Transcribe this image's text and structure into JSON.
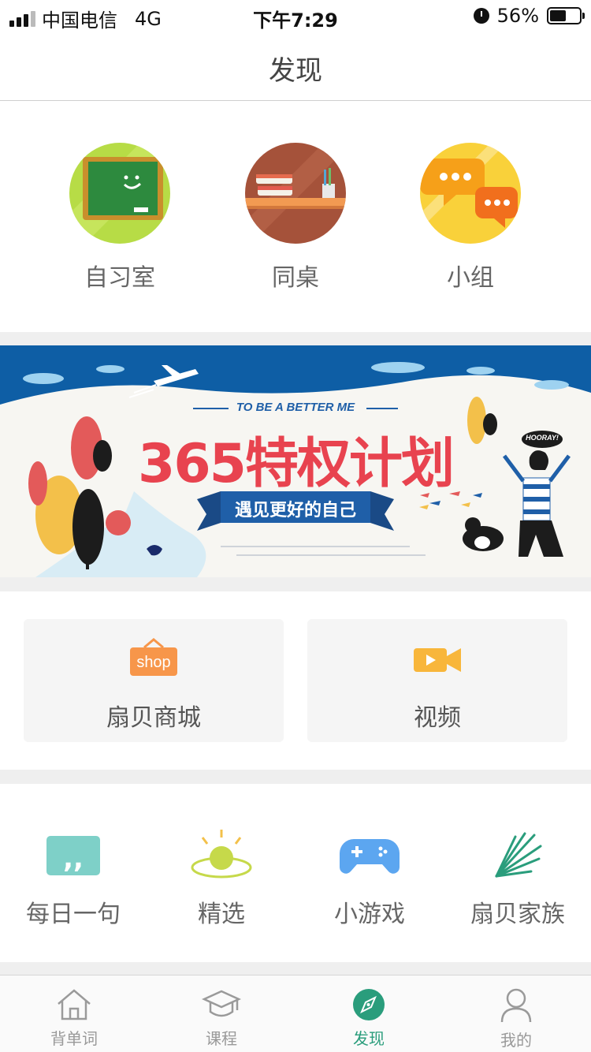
{
  "status_bar": {
    "carrier": "中国电信",
    "network": "4G",
    "time": "下午7:29",
    "battery_percent": "56%",
    "battery_level": 0.56
  },
  "header": {
    "title": "发现"
  },
  "top_items": [
    {
      "label": "自习室",
      "icon": "chalkboard-icon"
    },
    {
      "label": "同桌",
      "icon": "bookshelf-icon"
    },
    {
      "label": "小组",
      "icon": "chat-bubbles-icon"
    }
  ],
  "banner": {
    "tagline": "TO BE A BETTER ME",
    "title": "365特权计划",
    "subtitle": "遇见更好的自己",
    "speech": "HOORAY!"
  },
  "cards": [
    {
      "label": "扇贝商城",
      "icon": "shop-icon",
      "icon_text": "shop"
    },
    {
      "label": "视频",
      "icon": "video-camera-icon"
    }
  ],
  "features": [
    {
      "label": "每日一句",
      "icon": "quote-icon"
    },
    {
      "label": "精选",
      "icon": "sunrise-icon"
    },
    {
      "label": "小游戏",
      "icon": "gamepad-icon"
    },
    {
      "label": "扇贝家族",
      "icon": "leaf-burst-icon"
    }
  ],
  "tabbar": {
    "active_index": 2,
    "items": [
      {
        "label": "背单词",
        "icon": "home-icon"
      },
      {
        "label": "课程",
        "icon": "graduation-cap-icon"
      },
      {
        "label": "发现",
        "icon": "compass-icon"
      },
      {
        "label": "我的",
        "icon": "user-icon"
      }
    ]
  },
  "colors": {
    "accent": "#2a9d7c",
    "banner_title": "#e8434f",
    "banner_ribbon": "#1f5fa8",
    "shop_orange": "#f7964a",
    "video_yellow": "#f8b63b",
    "quote_teal": "#7ed0c8",
    "game_blue": "#5ca6f0"
  }
}
